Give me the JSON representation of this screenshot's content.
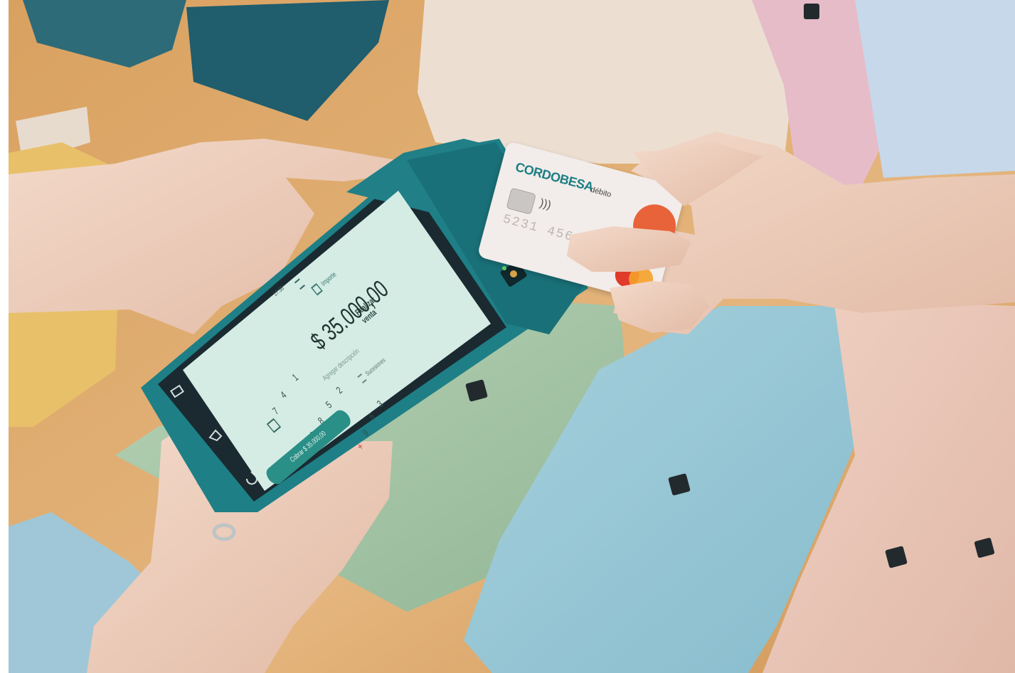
{
  "pos_screen": {
    "status_time": "17:58",
    "tabs": [
      "Importe",
      "Realizar venta",
      "Sucesiones"
    ],
    "amount": "$ 35.000,00",
    "add_description": "Agregar descripción",
    "keypad": [
      "1",
      "2",
      "3",
      "4",
      "5",
      "6",
      "7",
      "8",
      "9",
      "0"
    ],
    "charge_button": "Cobrar $ 35.000,00"
  },
  "card": {
    "brand": "CORDOBESA",
    "type": "débito",
    "number_fragment": "5231 456",
    "network": "mastercard-logo"
  },
  "colors": {
    "pos_body": "#1e7f86",
    "screen_bg": "#d4ece4",
    "charge_button": "#2a8f86",
    "card_bg": "#f2ecea",
    "card_brand": "#1a7f83"
  }
}
